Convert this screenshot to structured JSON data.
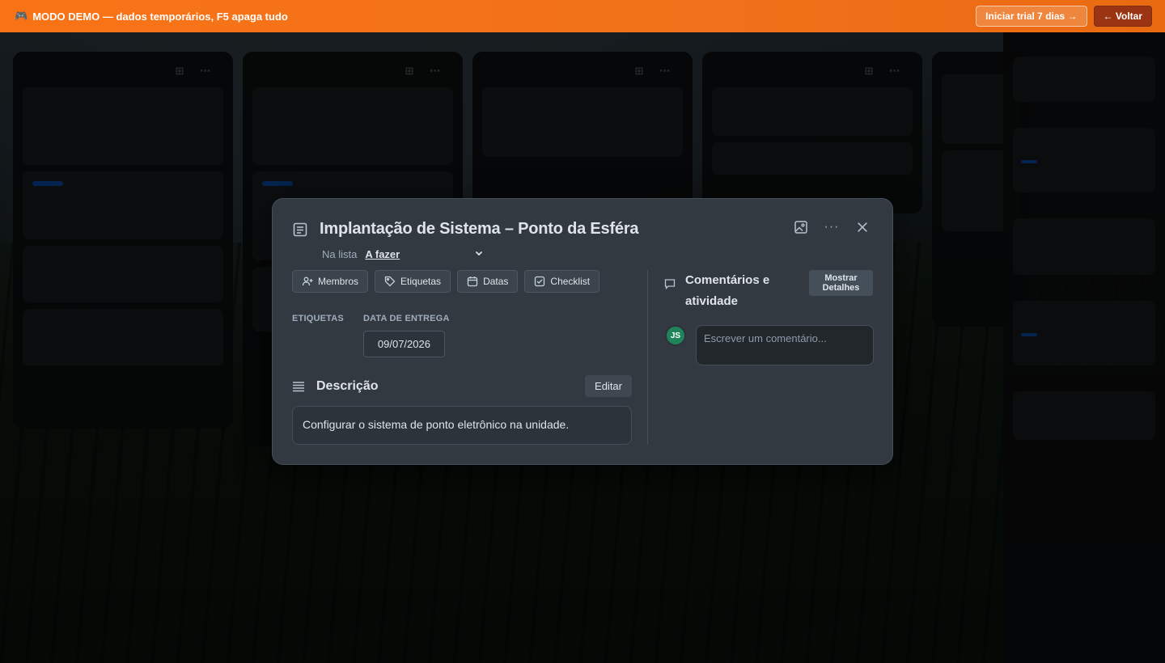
{
  "banner": {
    "text": "MODO DEMO — dados temporários, F5 apaga tudo",
    "icon": "game-controller-icon",
    "trial_label": "Iniciar trial 7 dias →",
    "back_label": "← Voltar",
    "color": "#f97316"
  },
  "modal": {
    "title": "Implantação de Sistema – Ponto da Esféra",
    "in_list_prefix": "Na lista",
    "list_name": "A fazer",
    "buttons": {
      "members": "Membros",
      "labels": "Etiquetas",
      "dates": "Datas",
      "checklist": "Checklist"
    },
    "labels_heading": "ETIQUETAS",
    "due_heading": "DATA DE ENTREGA",
    "due_date": "09/07/2026",
    "description_heading": "Descrição",
    "edit_label": "Editar",
    "description": "Configurar o sistema de ponto eletrônico na unidade.",
    "comments_heading": "Comentários e atividade",
    "show_details_label": "Mostrar Detalhes",
    "avatar_initials": "JS",
    "comment_placeholder": "Escrever um comentário..."
  }
}
